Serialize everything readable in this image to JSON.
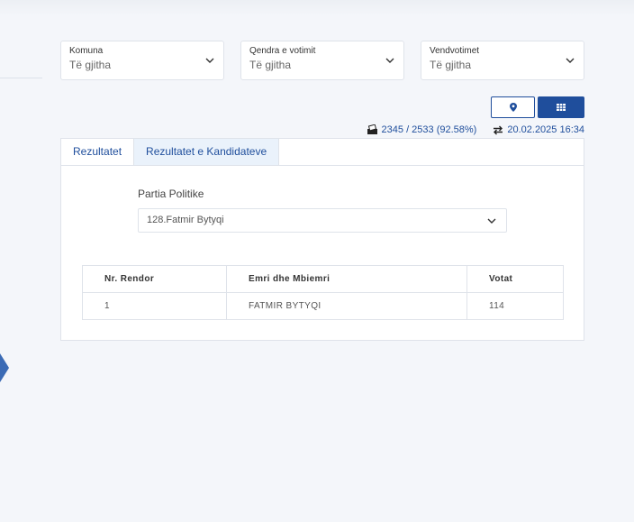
{
  "filters": [
    {
      "label": "Komuna",
      "value": "Të gjitha"
    },
    {
      "label": "Qendra e votimit",
      "value": "Të gjitha"
    },
    {
      "label": "Vendvotimet",
      "value": "Të gjitha"
    }
  ],
  "view_buttons": {
    "map_icon": "map-pin-icon",
    "table_icon": "grid-icon",
    "active": "table"
  },
  "stats": {
    "polling_stations": "2345 / 2533 (92.58%)",
    "updated": "20.02.2025 16:34",
    "polling_icon": "ballot-box-icon",
    "updated_icon": "sync-arrows-icon"
  },
  "tabs": [
    {
      "label": "Rezultatet",
      "active": false
    },
    {
      "label": "Rezultatet e Kandidateve",
      "active": true
    }
  ],
  "party": {
    "label": "Partia Politike",
    "selected": "128.Fatmir Bytyqi"
  },
  "results_table": {
    "headers": [
      "Nr. Rendor",
      "Emri dhe Mbiemri",
      "Votat"
    ],
    "rows": [
      [
        "1",
        "FATMIR BYTYQI",
        "114"
      ]
    ]
  },
  "colors": {
    "accent": "#1f4e9c",
    "tab_active_bg": "#eaf2fb",
    "page_bg": "#f4f6fa"
  }
}
